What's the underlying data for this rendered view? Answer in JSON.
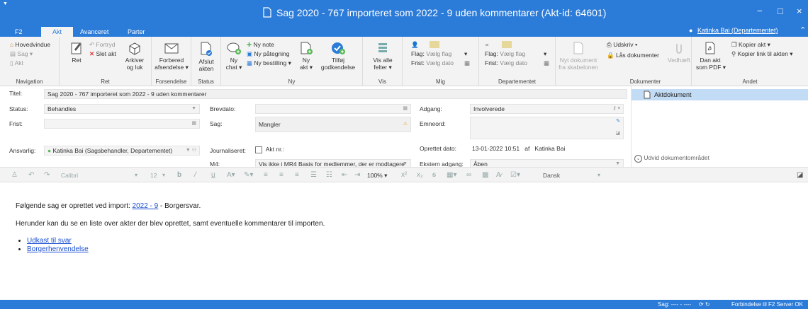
{
  "window": {
    "title": "Sag 2020 - 767 importeret som 2022 - 9 uden kommentarer (Akt-id: 64601)",
    "controls": {
      "minimize": "−",
      "maximize": "□",
      "close": "×"
    }
  },
  "tabs": [
    "F2",
    "Akt",
    "Avanceret",
    "Parter"
  ],
  "active_tab": "Akt",
  "user": "Katinka Bai (Departementet)",
  "ribbon": {
    "navigation": {
      "label": "Navigation",
      "hovedvindue": "Hovedvindue",
      "sag": "Sag ▾",
      "akt": "Akt"
    },
    "ret": {
      "label": "Ret",
      "ret": "Ret",
      "fortryd": "Fortryd",
      "slet_akt": "Slet akt",
      "arkiver_line1": "Arkiver",
      "arkiver_line2": "og luk"
    },
    "forsendelse": {
      "label": "Forsendelse",
      "line1": "Forbered",
      "line2": "afsendelse ▾"
    },
    "status": {
      "label": "Status",
      "line1": "Afslut",
      "line2": "akten"
    },
    "ny": {
      "label": "Ny",
      "ny_chat_1": "Ny",
      "ny_chat_2": "chat ▾",
      "ny_note": "Ny note",
      "ny_paategning": "Ny påtegning",
      "ny_bestilling": "Ny bestilling ▾",
      "ny_akt_1": "Ny",
      "ny_akt_2": "akt ▾",
      "tilfoej_1": "Tilføj",
      "tilfoej_2": "godkendelse"
    },
    "vis": {
      "label": "Vis",
      "line1": "Vis alle",
      "line2": "felter ▾"
    },
    "mig": {
      "label": "Mig",
      "flag": "Flag:",
      "flag_val": "Vælg flag",
      "frist": "Frist:",
      "frist_val": "Vælg dato"
    },
    "departementet": {
      "label": "Departementet",
      "flag": "Flag:",
      "flag_val": "Vælg flag",
      "frist": "Frist:",
      "frist_val": "Vælg dato"
    },
    "nyt_dok": {
      "line1": "Nyt dokument",
      "line2": "fra skabelonen"
    },
    "dokumenter": {
      "label": "Dokumenter",
      "udskriv": "Udskriv ▾",
      "laas": "Lås dokumenter",
      "vedhaeft": "Vedhæft"
    },
    "andet": {
      "label": "Andet",
      "dan_akt_1": "Dan akt",
      "dan_akt_2": "som PDF ▾",
      "kopier_akt": "Kopier akt ▾",
      "kopier_link": "Kopier link til akten ▾"
    }
  },
  "form": {
    "titel_label": "Titel:",
    "titel_value": "Sag 2020 - 767 importeret som 2022 - 9 uden kommentarer",
    "status_label": "Status:",
    "status_value": "Behandles",
    "frist_label": "Frist:",
    "ansvarlig_label": "Ansvarlig:",
    "ansvarlig_value": "Katinka Bai (Sagsbehandler, Departementet)",
    "brevdato_label": "Brevdato:",
    "sag_label": "Sag:",
    "sag_value": "Mangler",
    "journaliseret_label": "Journaliseret:",
    "aktnr_label": "Akt nr.:",
    "m4_label": "M4:",
    "m4_value": "Vis ikke i MR4 Basis for medlemmer, der er modtagere",
    "adgang_label": "Adgang:",
    "adgang_value": "Involverede",
    "emneord_label": "Emneord:",
    "oprettet_label": "Oprettet dato:",
    "oprettet_value": "13-01-2022 10:51",
    "af_label": "af",
    "oprettet_af": "Katinka Bai",
    "ekstern_label": "Ekstern adgang:",
    "ekstern_value": "Åben"
  },
  "doc_pane": {
    "aktdokument": "Aktdokument",
    "udvid": "Udvid dokumentområdet"
  },
  "format_bar": {
    "font": "Calibri",
    "size": "12",
    "zoom": "100% ▾",
    "language": "Dansk"
  },
  "content": {
    "line1_pre": "Følgende sag er oprettet ved import: ",
    "line1_link": "2022 - 9",
    "line1_post": " - Borgersvar.",
    "line2": "Herunder kan du se en liste over akter der blev oprettet, samt eventuelle kommentarer til importen.",
    "links": [
      "Udkast til svar",
      "Borgerhenvendelse"
    ]
  },
  "status_bar": {
    "sag": "Sag: ---- - ----",
    "connection": "Forbindelse til F2 Server OK"
  },
  "colors": {
    "accent": "#2b7bd9",
    "selected": "#c3dcf5",
    "link": "#1a4fd1",
    "delete": "#d83b3b",
    "green_status": "#5cb85c"
  }
}
